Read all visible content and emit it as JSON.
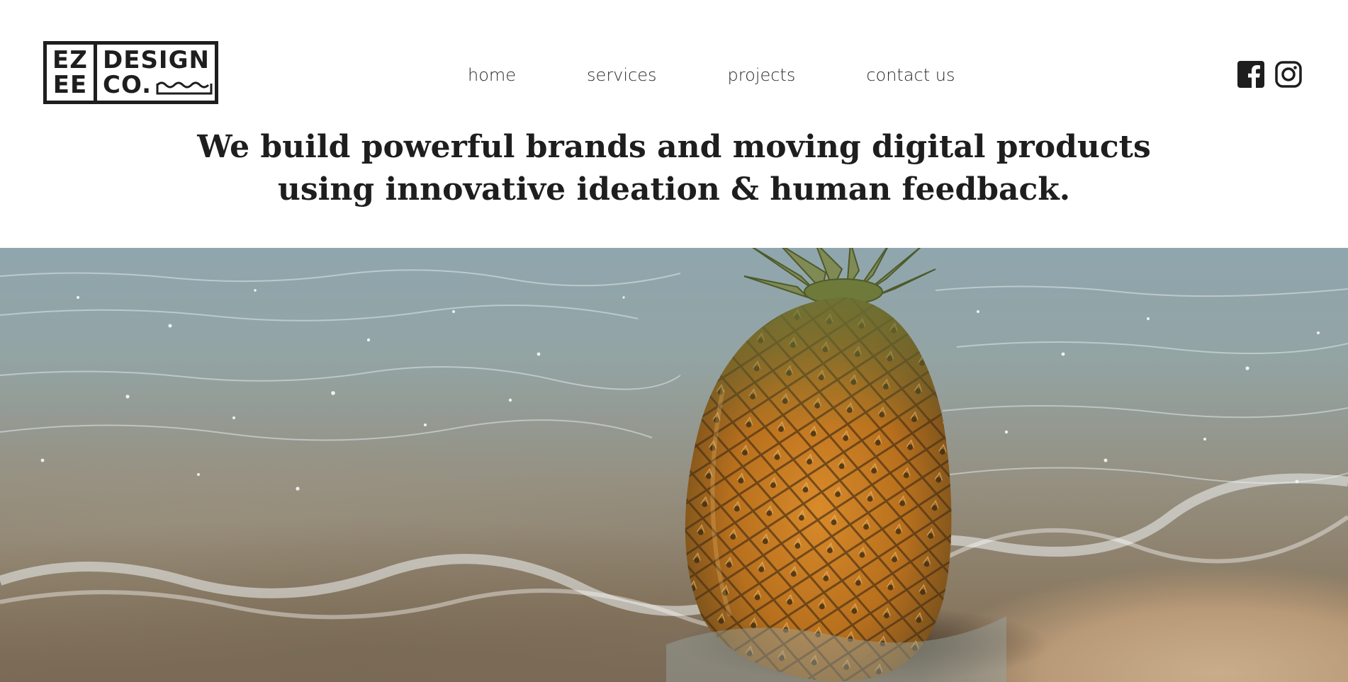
{
  "brand": {
    "logo_left_top": "EZ",
    "logo_left_bottom": "EE",
    "logo_right_top": "DESIGN",
    "logo_right_bottom": "CO."
  },
  "nav": {
    "items": [
      {
        "label": "home"
      },
      {
        "label": "services"
      },
      {
        "label": "projects"
      },
      {
        "label": "contact us"
      }
    ]
  },
  "social": {
    "icons": [
      "facebook-icon",
      "instagram-icon"
    ]
  },
  "hero": {
    "tagline_line1": "We build powerful brands and moving digital products",
    "tagline_line2": "using innovative ideation & human feedback.",
    "image_subject": "pineapple-on-beach"
  },
  "colors": {
    "text": "#1e1e1e",
    "background": "#ffffff",
    "water": "#8fa6ae",
    "sand": "#c9ad8b",
    "pineapple": "#c47a1e",
    "leaves": "#6f7d3e"
  }
}
